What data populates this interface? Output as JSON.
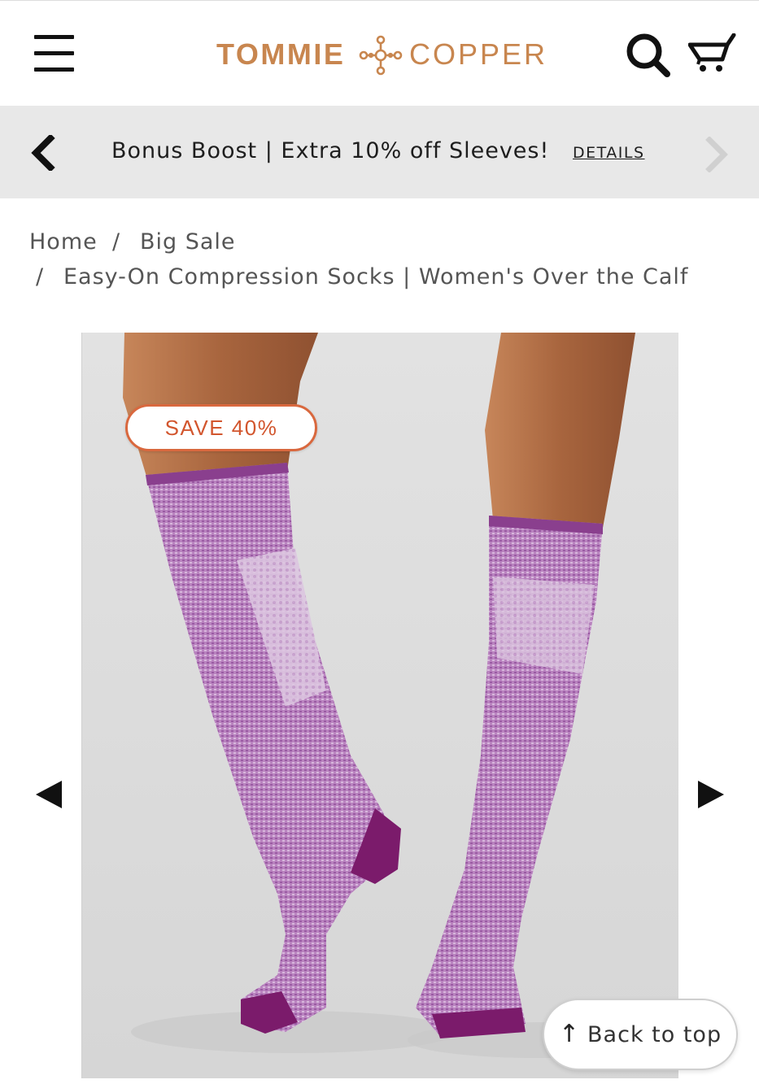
{
  "header": {
    "brand": {
      "word1": "TOMMIE",
      "word2": "COPPER",
      "color": "#c8864f"
    },
    "icons": {
      "menu": "hamburger-menu-icon",
      "search": "search-icon",
      "cart": "cart-icon"
    }
  },
  "promo": {
    "text": "Bonus Boost | Extra 10% off Sleeves!",
    "link": "DETAILS"
  },
  "breadcrumb": {
    "home": "Home",
    "sep": "/",
    "category": "Big Sale",
    "current": "Easy-On Compression Socks | Women's Over the Calf"
  },
  "product": {
    "badge": "SAVE 40%",
    "sock_color": "#b17ab8",
    "accent_color": "#7b1b6b",
    "badge_color": "#d9683e"
  },
  "back_to_top": {
    "arrow": "↑",
    "label": "Back to top"
  }
}
